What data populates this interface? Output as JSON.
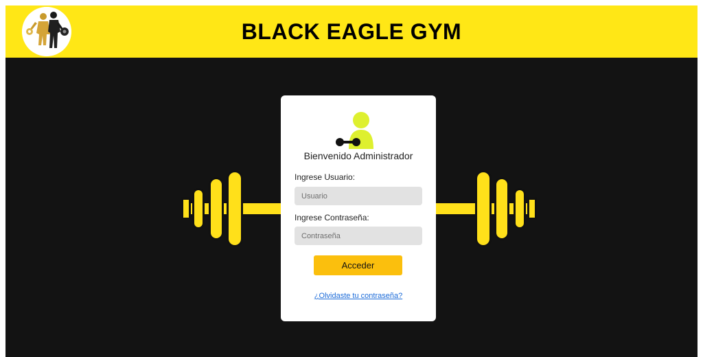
{
  "header": {
    "title": "BLACK EAGLE GYM",
    "logo_icon": "gym-athletes-logo",
    "background_color": "#ffe716"
  },
  "background": {
    "color": "#131313",
    "decoration_icon": "barbell-icon",
    "decoration_color": "#ffe01a"
  },
  "login": {
    "avatar_icon": "admin-user-dumbbell-icon",
    "welcome": "Bienvenido Administrador",
    "user_label": "Ingrese Usuario:",
    "user_placeholder": "Usuario",
    "user_value": "",
    "password_label": "Ingrese Contraseña:",
    "password_placeholder": "Contraseña",
    "password_value": "",
    "submit_label": "Acceder",
    "submit_color": "#fbbf0d",
    "forgot_link": "¿Olvidaste tu contraseña?",
    "link_color": "#1a6ad8"
  }
}
